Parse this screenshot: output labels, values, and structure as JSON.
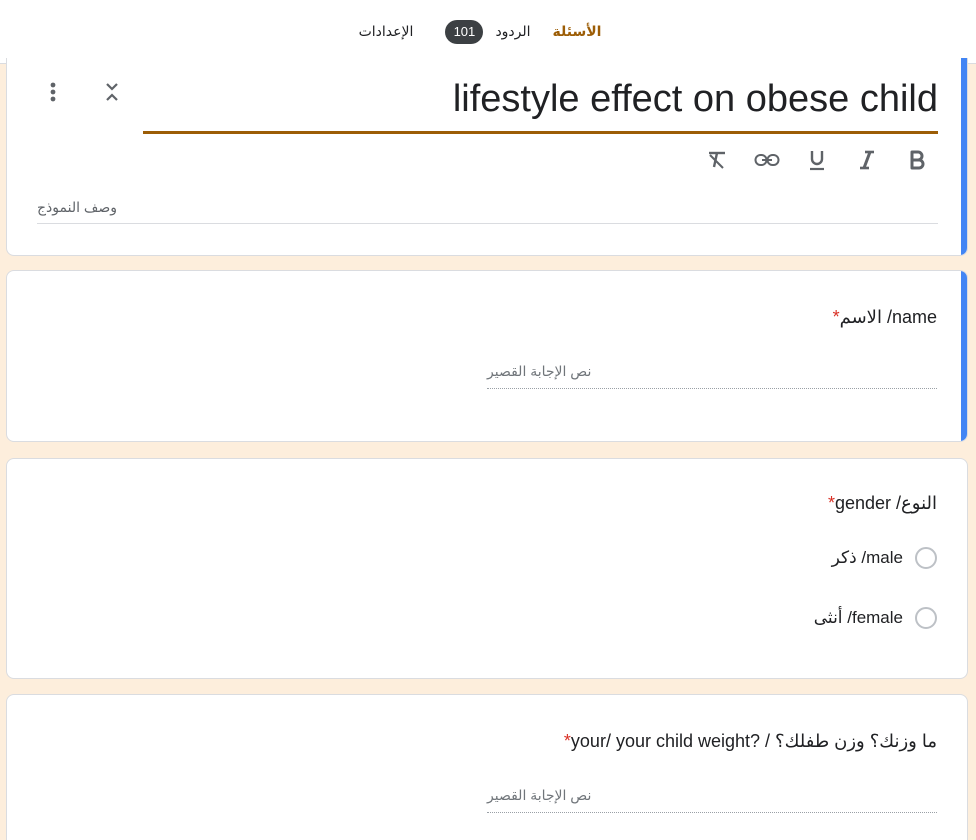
{
  "tabs": {
    "questions": "الأسئلة",
    "responses": "الردود",
    "responses_count": "101",
    "settings": "الإعدادات"
  },
  "form": {
    "title": "lifestyle effect on obese child",
    "description_placeholder": "وصف النموذج"
  },
  "toolbar": {
    "icons": [
      "bold-icon",
      "italic-icon",
      "underline-icon",
      "link-icon",
      "clear-format-icon"
    ]
  },
  "questions": [
    {
      "title": "name/ الاسم",
      "required_mark": "*",
      "answer_placeholder": "نص الإجابة القصير"
    },
    {
      "title": "النوع/ gender",
      "required_mark": "*",
      "options": [
        "male/ ذكر",
        "female/ أنثى"
      ]
    },
    {
      "title": "ما وزنك؟ وزن طفلك؟ / ?your/ your child weight",
      "required_mark": "*",
      "answer_placeholder": "نص الإجابة القصير"
    }
  ],
  "colors": {
    "accent": "#9c5d06",
    "background": "#fdeedc",
    "active_indicator": "#4285f4",
    "required": "#d93025",
    "badge_bg": "#3c4043"
  }
}
